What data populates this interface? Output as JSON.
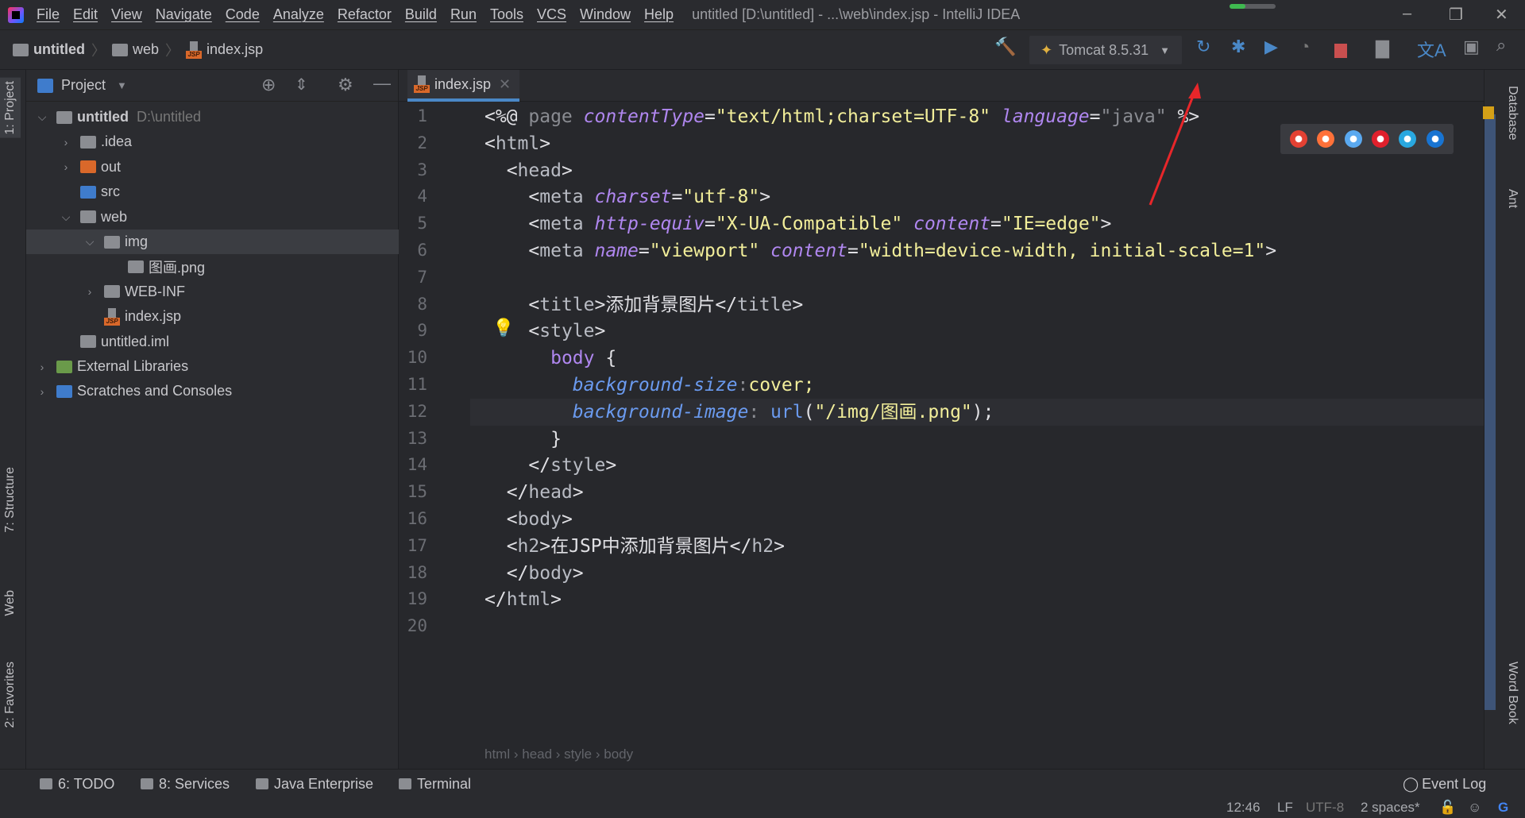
{
  "menu": [
    "File",
    "Edit",
    "View",
    "Navigate",
    "Code",
    "Analyze",
    "Refactor",
    "Build",
    "Run",
    "Tools",
    "VCS",
    "Window",
    "Help"
  ],
  "window_title": "untitled [D:\\untitled] - ...\\web\\index.jsp - IntelliJ IDEA",
  "build_progress_percent": 35,
  "breadcrumb": [
    "untitled",
    "web",
    "index.jsp"
  ],
  "run_config": "Tomcat 8.5.31",
  "left_tabs": [
    "1: Project",
    "7: Structure",
    "Web",
    "2: Favorites"
  ],
  "right_tabs": [
    "Database",
    "Ant",
    "Word Book"
  ],
  "project": {
    "title": "Project",
    "tree": [
      {
        "label": "untitled",
        "hint": "D:\\untitled",
        "level": 0,
        "arrow": "open",
        "icon": "module-folder",
        "bold": true
      },
      {
        "label": ".idea",
        "level": 1,
        "arrow": "closed",
        "icon": "folder"
      },
      {
        "label": "out",
        "level": 1,
        "arrow": "closed",
        "icon": "folder-orange"
      },
      {
        "label": "src",
        "level": 1,
        "arrow": "",
        "icon": "folder-blue"
      },
      {
        "label": "web",
        "level": 1,
        "arrow": "open",
        "icon": "web-folder"
      },
      {
        "label": "img",
        "level": 2,
        "arrow": "open",
        "icon": "folder",
        "selected": true
      },
      {
        "label": "图画.png",
        "level": 3,
        "arrow": "",
        "icon": "image-file"
      },
      {
        "label": "WEB-INF",
        "level": 2,
        "arrow": "closed",
        "icon": "folder"
      },
      {
        "label": "index.jsp",
        "level": 2,
        "arrow": "",
        "icon": "jsp-file"
      },
      {
        "label": "untitled.iml",
        "level": 1,
        "arrow": "",
        "icon": "iml-file"
      },
      {
        "label": "External Libraries",
        "level": 0,
        "arrow": "closed",
        "icon": "libraries"
      },
      {
        "label": "Scratches and Consoles",
        "level": 0,
        "arrow": "closed",
        "icon": "scratches"
      }
    ]
  },
  "editor": {
    "tab": "index.jsp",
    "current_line": 12,
    "lines": [
      [
        [
          "<%@ ",
          "br"
        ],
        [
          "page ",
          "gray"
        ],
        [
          "contentType",
          "attr"
        ],
        [
          "=",
          "br"
        ],
        [
          "\"text/html;charset=UTF-8\"",
          "str"
        ],
        [
          " ",
          "br"
        ],
        [
          "language",
          "attr"
        ],
        [
          "=",
          "br"
        ],
        [
          "\"java\"",
          "gray"
        ],
        [
          " %>",
          "br"
        ]
      ],
      [
        [
          "<",
          "br"
        ],
        [
          "html",
          "tag"
        ],
        [
          ">",
          "br"
        ]
      ],
      [
        [
          "  <",
          "br"
        ],
        [
          "head",
          "tag"
        ],
        [
          ">",
          "br"
        ]
      ],
      [
        [
          "    <",
          "br"
        ],
        [
          "meta ",
          "tag"
        ],
        [
          "charset",
          "attr"
        ],
        [
          "=",
          "br"
        ],
        [
          "\"utf-8\"",
          "str"
        ],
        [
          ">",
          "br"
        ]
      ],
      [
        [
          "    <",
          "br"
        ],
        [
          "meta ",
          "tag"
        ],
        [
          "http-equiv",
          "attr"
        ],
        [
          "=",
          "br"
        ],
        [
          "\"X-UA-Compatible\"",
          "str"
        ],
        [
          " ",
          "br"
        ],
        [
          "content",
          "attr"
        ],
        [
          "=",
          "br"
        ],
        [
          "\"IE=edge\"",
          "str"
        ],
        [
          ">",
          "br"
        ]
      ],
      [
        [
          "    <",
          "br"
        ],
        [
          "meta ",
          "tag"
        ],
        [
          "name",
          "attr"
        ],
        [
          "=",
          "br"
        ],
        [
          "\"viewport\"",
          "str"
        ],
        [
          " ",
          "br"
        ],
        [
          "content",
          "attr"
        ],
        [
          "=",
          "br"
        ],
        [
          "\"width=device-width, initial-scale=1\"",
          "str"
        ],
        [
          ">",
          "br"
        ]
      ],
      [],
      [
        [
          "    <",
          "br"
        ],
        [
          "title",
          "tag"
        ],
        [
          ">",
          "br"
        ],
        [
          "添加背景图片",
          "txt"
        ],
        [
          "</",
          "br"
        ],
        [
          "title",
          "tag"
        ],
        [
          ">",
          "br"
        ]
      ],
      [
        [
          "    <",
          "br"
        ],
        [
          "style",
          "tag"
        ],
        [
          ">",
          "br"
        ]
      ],
      [
        [
          "      ",
          "br"
        ],
        [
          "body",
          "sel"
        ],
        [
          " {",
          "br"
        ]
      ],
      [
        [
          "        ",
          "br"
        ],
        [
          "background-size",
          "prop"
        ],
        [
          ":",
          "gray"
        ],
        [
          "cover;",
          "val"
        ]
      ],
      [
        [
          "        ",
          "br"
        ],
        [
          "background-image",
          "prop"
        ],
        [
          ": ",
          "gray"
        ],
        [
          "url",
          "fn"
        ],
        [
          "(",
          "br"
        ],
        [
          "\"/img/图画.png\"",
          "str"
        ],
        [
          ");",
          "br"
        ]
      ],
      [
        [
          "      }",
          "br"
        ]
      ],
      [
        [
          "    </",
          "br"
        ],
        [
          "style",
          "tag"
        ],
        [
          ">",
          "br"
        ]
      ],
      [
        [
          "  </",
          "br"
        ],
        [
          "head",
          "tag"
        ],
        [
          ">",
          "br"
        ]
      ],
      [
        [
          "  <",
          "br"
        ],
        [
          "body",
          "tag"
        ],
        [
          ">",
          "br"
        ]
      ],
      [
        [
          "  <",
          "br"
        ],
        [
          "h2",
          "tag"
        ],
        [
          ">",
          "br"
        ],
        [
          "在JSP中添加背景图片",
          "txt"
        ],
        [
          "</",
          "br"
        ],
        [
          "h2",
          "tag"
        ],
        [
          ">",
          "br"
        ]
      ],
      [
        [
          "  </",
          "br"
        ],
        [
          "body",
          "tag"
        ],
        [
          ">",
          "br"
        ]
      ],
      [
        [
          "</",
          "br"
        ],
        [
          "html",
          "tag"
        ],
        [
          ">",
          "br"
        ]
      ],
      []
    ],
    "breadcrumb": [
      "html",
      "head",
      "style",
      "body"
    ]
  },
  "browsers": [
    {
      "name": "chrome",
      "color": "#e34133"
    },
    {
      "name": "firefox",
      "color": "#ff7139"
    },
    {
      "name": "safari",
      "color": "#5aa9f0"
    },
    {
      "name": "opera",
      "color": "#e0202c"
    },
    {
      "name": "internet-explorer",
      "color": "#29a8e0"
    },
    {
      "name": "edge",
      "color": "#1874d2"
    }
  ],
  "bottom_tools": [
    "6: TODO",
    "8: Services",
    "Java Enterprise",
    "Terminal"
  ],
  "event_log": "Event Log",
  "status": {
    "position": "12:46",
    "line_sep": "LF",
    "encoding": "UTF-8",
    "indent": "2 spaces*"
  }
}
